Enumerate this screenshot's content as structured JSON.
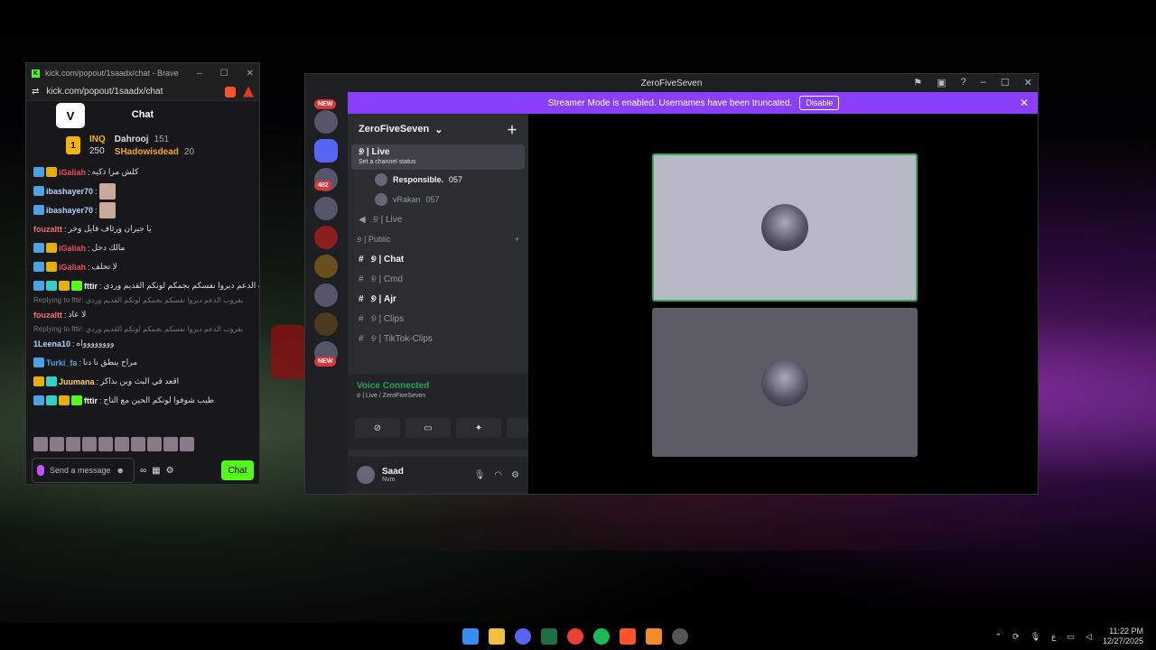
{
  "kick": {
    "tab_title": "kick.com/popout/1saadx/chat - Brave",
    "url": "kick.com/popout/1saadx/chat",
    "chat_title": "Chat",
    "leader": {
      "rank": "1",
      "first_name": "INQ",
      "first_count": "250",
      "users": [
        {
          "name": "Dahrooj",
          "count": "151"
        },
        {
          "name": "SHadowisdead",
          "count": "20"
        }
      ]
    },
    "messages": [
      {
        "user": "iGaliah",
        "text": "كلش مرا ذكيه",
        "ucls": "u2",
        "badges": [
          "b-blue",
          "b-gold"
        ]
      },
      {
        "user": "ibashayer70",
        "text": "",
        "ucls": "u3",
        "badges": [
          "b-blue"
        ],
        "thumb": true
      },
      {
        "user": "ibashayer70",
        "text": "",
        "ucls": "u3",
        "badges": [
          "b-blue"
        ],
        "thumb": true
      },
      {
        "user": "fouzaltt",
        "text": "يا جيران ورئاف فايل وخر",
        "ucls": "u4",
        "badges": []
      },
      {
        "user": "iGaliah",
        "text": "مالك دخل",
        "ucls": "u2",
        "badges": [
          "b-blue",
          "b-gold"
        ]
      },
      {
        "user": "iGaliah",
        "text": "لا تحلف",
        "ucls": "u2",
        "badges": [
          "b-blue",
          "b-gold"
        ]
      },
      {
        "user": "fttir",
        "text": "بقروب الدعم ديروا نفسكم بجمكم لونكم القديم وردي",
        "ucls": "u6",
        "badges": [
          "b-blue",
          "b-teal",
          "b-gold",
          "b-green"
        ]
      },
      {
        "reply": "Replying to fttir: بقروب الدعم ديروا نفسكم بجمكم لونكم القديم وردي"
      },
      {
        "user": "fouzaltt",
        "text": "لا عاد",
        "ucls": "u4",
        "badges": []
      },
      {
        "reply": "Replying to fttir: بقروب الدعم ديروا نفسكم بجمكم لونكم القديم وردي"
      },
      {
        "user": "1Leena10",
        "text": "وووووووواه",
        "ucls": "u3",
        "badges": []
      },
      {
        "user": "Turki_fa",
        "text": "مراح ينطق نا دنا",
        "ucls": "u1",
        "badges": [
          "b-blue"
        ]
      },
      {
        "user": "Juumana",
        "text": "اقعد في البث وين بذاكر",
        "ucls": "u5",
        "badges": [
          "b-gold",
          "b-teal"
        ]
      },
      {
        "user": "fttir",
        "text": "طيب شوفوا لونكم الحين مع التاج",
        "ucls": "u6",
        "badges": [
          "b-blue",
          "b-teal",
          "b-gold",
          "b-green"
        ]
      }
    ],
    "send_placeholder": "Send a message",
    "chat_button": "Chat"
  },
  "discord": {
    "window_title": "ZeroFiveSeven",
    "banner_text": "Streamer Mode is enabled. Usernames have been truncated.",
    "banner_button": "Disable",
    "server_name": "ZeroFiveSeven",
    "live_channel": "୭ | Live",
    "live_status": "Set a channel status",
    "voice_users": [
      {
        "name": "Responsible.",
        "tag": "057"
      },
      {
        "name": "vRakan",
        "tag": "057"
      }
    ],
    "live2": "୭ | Live",
    "category": "୭ | Public",
    "text_channels": [
      "୭ | Chat",
      "୭ | Cmd",
      "୭ | Ajr",
      "୭ | Clips",
      "୭ | TikTok-Clips"
    ],
    "voice_connected": "Voice Connected",
    "voice_sub": "୭ | Live / ZeroFiveSeven",
    "user_name": "Saad",
    "user_status": "Nvm",
    "badges": {
      "new": "NEW",
      "count1": "2",
      "count402": "402",
      "count1b": "1",
      "new2": "NEW"
    }
  },
  "taskbar": {
    "time": "11:22 PM",
    "date": "12/27/2025",
    "lang": "ع"
  }
}
